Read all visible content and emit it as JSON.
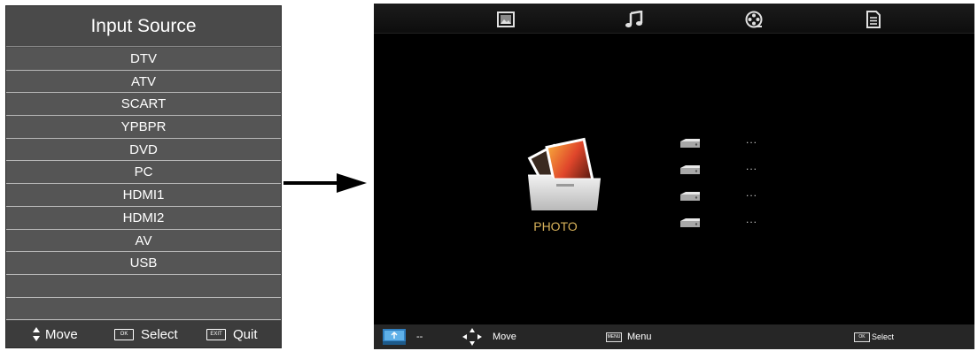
{
  "input_source": {
    "title": "Input Source",
    "items": [
      {
        "label": "DTV"
      },
      {
        "label": "ATV"
      },
      {
        "label": "SCART"
      },
      {
        "label": "YPBPR"
      },
      {
        "label": "DVD"
      },
      {
        "label": "PC"
      },
      {
        "label": "HDMI1"
      },
      {
        "label": "HDMI2"
      },
      {
        "label": "AV"
      },
      {
        "label": "USB"
      },
      {
        "label": ""
      },
      {
        "label": ""
      }
    ],
    "footer": {
      "move_label": "Move",
      "select_key": "OK",
      "select_label": "Select",
      "quit_key": "EXIT",
      "quit_label": "Quit"
    }
  },
  "media_screen": {
    "tabs": [
      {
        "icon": "photo-icon"
      },
      {
        "icon": "music-icon"
      },
      {
        "icon": "movie-icon"
      },
      {
        "icon": "text-icon"
      }
    ],
    "selected_folder": {
      "label": "PHOTO",
      "icon": "photo-folder-icon"
    },
    "drives": [
      {
        "icon": "drive-icon",
        "value": "..."
      },
      {
        "icon": "drive-icon",
        "value": "..."
      },
      {
        "icon": "drive-icon",
        "value": "..."
      },
      {
        "icon": "drive-icon",
        "value": "..."
      }
    ],
    "footer": {
      "usb_value": "--",
      "move_label": "Move",
      "menu_key": "MENU",
      "menu_label": "Menu",
      "select_key": "OK",
      "select_label": "Select"
    },
    "colors": {
      "folder_label": "#d8b25a",
      "background": "#000000",
      "bar": "#262626"
    }
  }
}
